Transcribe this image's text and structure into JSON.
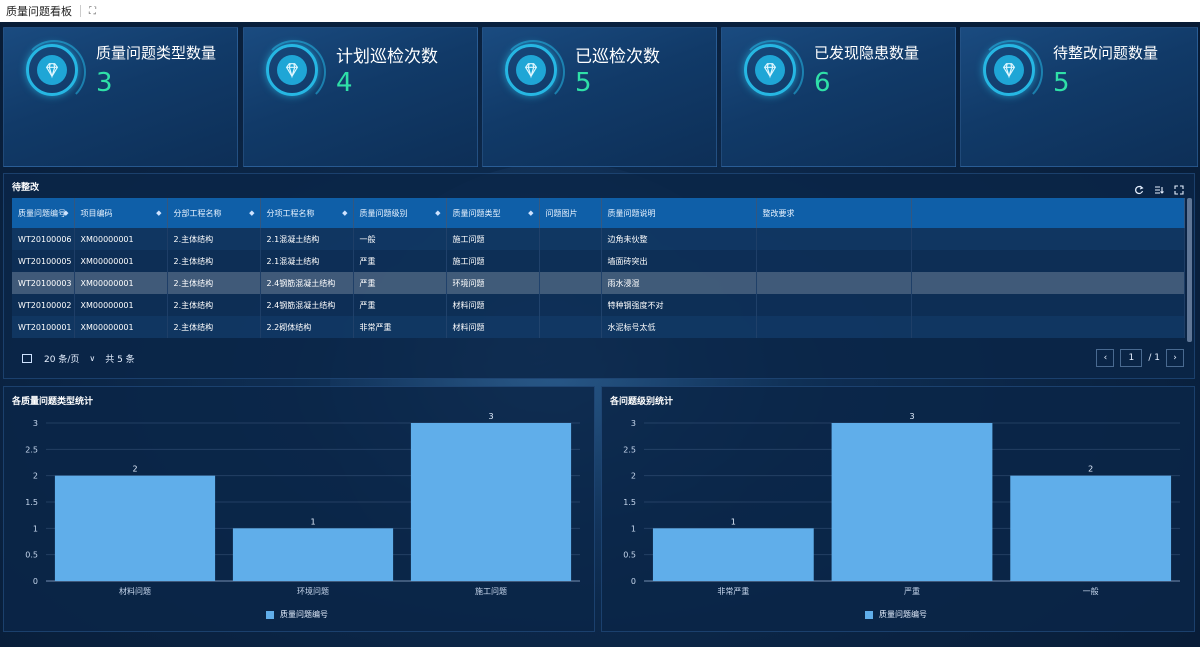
{
  "window": {
    "title": "质量问题看板"
  },
  "stats": [
    {
      "label": "质量问题类型数量",
      "value": "3"
    },
    {
      "label": "计划巡检次数",
      "value": "4"
    },
    {
      "label": "已巡检次数",
      "value": "5"
    },
    {
      "label": "已发现隐患数量",
      "value": "6"
    },
    {
      "label": "待整改问题数量",
      "value": "5"
    }
  ],
  "table": {
    "title": "待整改",
    "columns": [
      "质量问题编号",
      "项目编码",
      "分部工程名称",
      "分项工程名称",
      "质量问题级别",
      "质量问题类型",
      "问题图片",
      "质量问题说明",
      "整改要求"
    ],
    "rows": [
      [
        "WT20100006",
        "XM00000001",
        "2.主体结构",
        "2.1混凝土结构",
        "一般",
        "施工问题",
        "",
        "边角未伙整",
        ""
      ],
      [
        "WT20100005",
        "XM00000001",
        "2.主体结构",
        "2.1混凝土结构",
        "严重",
        "施工问题",
        "",
        "墙面砖突出",
        ""
      ],
      [
        "WT20100003",
        "XM00000001",
        "2.主体结构",
        "2.4钢筋混凝土结构",
        "严重",
        "环境问题",
        "",
        "雨水浸湿",
        ""
      ],
      [
        "WT20100002",
        "XM00000001",
        "2.主体结构",
        "2.4钢筋混凝土结构",
        "严重",
        "材料问题",
        "",
        "特种钢强度不对",
        ""
      ],
      [
        "WT20100001",
        "XM00000001",
        "2.主体结构",
        "2.2砌体结构",
        "非常严重",
        "材料问题",
        "",
        "水泥标号太低",
        ""
      ]
    ],
    "pager": {
      "page_size": "20 条/页",
      "total": "共 5 条",
      "current": "1",
      "pages": "/ 1"
    }
  },
  "colors": {
    "bar": "#60aeea",
    "accent": "#2fe0a8",
    "header": "#0f5fa8"
  },
  "icons": [
    "diamond-icon",
    "refresh-icon",
    "column-settings-icon",
    "fullscreen-icon"
  ],
  "chart_data": [
    {
      "type": "bar",
      "title": "各质量问题类型统计",
      "categories": [
        "材料问题",
        "环境问题",
        "施工问题"
      ],
      "series": [
        {
          "name": "质量问题编号",
          "values": [
            2,
            1,
            3
          ]
        }
      ],
      "yticks": [
        "0",
        "0.5",
        "1",
        "1.5",
        "2",
        "2.5",
        "3"
      ],
      "ylim": [
        0,
        3
      ],
      "legend": "bottom-center",
      "grid": true
    },
    {
      "type": "bar",
      "title": "各问题级别统计",
      "categories": [
        "非常严重",
        "严重",
        "一般"
      ],
      "series": [
        {
          "name": "质量问题编号",
          "values": [
            1,
            3,
            2
          ]
        }
      ],
      "yticks": [
        "0",
        "0.5",
        "1",
        "1.5",
        "2",
        "2.5",
        "3"
      ],
      "ylim": [
        0,
        3
      ],
      "legend": "bottom-center",
      "grid": true
    }
  ]
}
